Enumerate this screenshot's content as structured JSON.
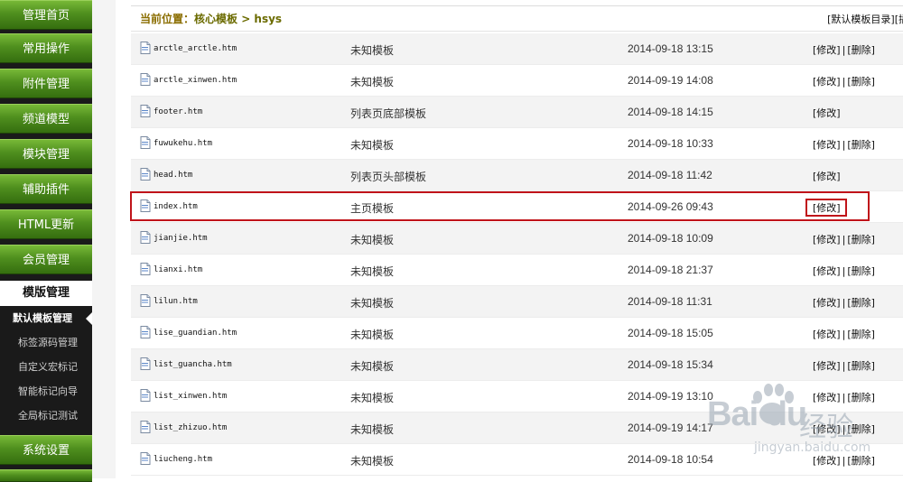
{
  "sidebar": {
    "items_top": [
      "管理首页",
      "常用操作",
      "附件管理",
      "频道模型",
      "模块管理",
      "辅助插件",
      "HTML更新",
      "会员管理"
    ],
    "active_section": "模版管理",
    "sub_items": [
      "默认模板管理",
      "标签源码管理",
      "自定义宏标记",
      "智能标记向导",
      "全局标记测试"
    ],
    "items_bottom": [
      "系统设置"
    ]
  },
  "breadcrumb": {
    "label": "当前位置：",
    "path": "核心模板 > hsys"
  },
  "top_links": {
    "link1": "[默认模板目录]",
    "link2": "[插"
  },
  "ops": {
    "edit": "[修改]",
    "sep": "|",
    "delete": "[删除]"
  },
  "files": [
    {
      "name": "arctle_arctle.htm",
      "desc": "未知模板",
      "date": "2014-09-18 13:15",
      "deletable": true
    },
    {
      "name": "arctle_xinwen.htm",
      "desc": "未知模板",
      "date": "2014-09-19 14:08",
      "deletable": true
    },
    {
      "name": "footer.htm",
      "desc": "列表页底部模板",
      "date": "2014-09-18 14:15",
      "deletable": false
    },
    {
      "name": "fuwukehu.htm",
      "desc": "未知模板",
      "date": "2014-09-18 10:33",
      "deletable": true
    },
    {
      "name": "head.htm",
      "desc": "列表页头部模板",
      "date": "2014-09-18 11:42",
      "deletable": false
    },
    {
      "name": "index.htm",
      "desc": "主页模板",
      "date": "2014-09-26 09:43",
      "deletable": false
    },
    {
      "name": "jianjie.htm",
      "desc": "未知模板",
      "date": "2014-09-18 10:09",
      "deletable": true
    },
    {
      "name": "lianxi.htm",
      "desc": "未知模板",
      "date": "2014-09-18 21:37",
      "deletable": true
    },
    {
      "name": "lilun.htm",
      "desc": "未知模板",
      "date": "2014-09-18 11:31",
      "deletable": true
    },
    {
      "name": "lise_guandian.htm",
      "desc": "未知模板",
      "date": "2014-09-18 15:05",
      "deletable": true
    },
    {
      "name": "list_guancha.htm",
      "desc": "未知模板",
      "date": "2014-09-18 15:34",
      "deletable": true
    },
    {
      "name": "list_xinwen.htm",
      "desc": "未知模板",
      "date": "2014-09-19 13:10",
      "deletable": true
    },
    {
      "name": "list_zhizuo.htm",
      "desc": "未知模板",
      "date": "2014-09-19 14:17",
      "deletable": true
    },
    {
      "name": "liucheng.htm",
      "desc": "未知模板",
      "date": "2014-09-18 10:54",
      "deletable": true
    }
  ],
  "watermark": {
    "brand": "Bai du",
    "cn": "经验",
    "url": "jingyan.baidu.com"
  },
  "colors": {
    "nav_green": "#4f8f1e",
    "highlight_red": "#c0141a",
    "crumb": "#6b6b00"
  }
}
